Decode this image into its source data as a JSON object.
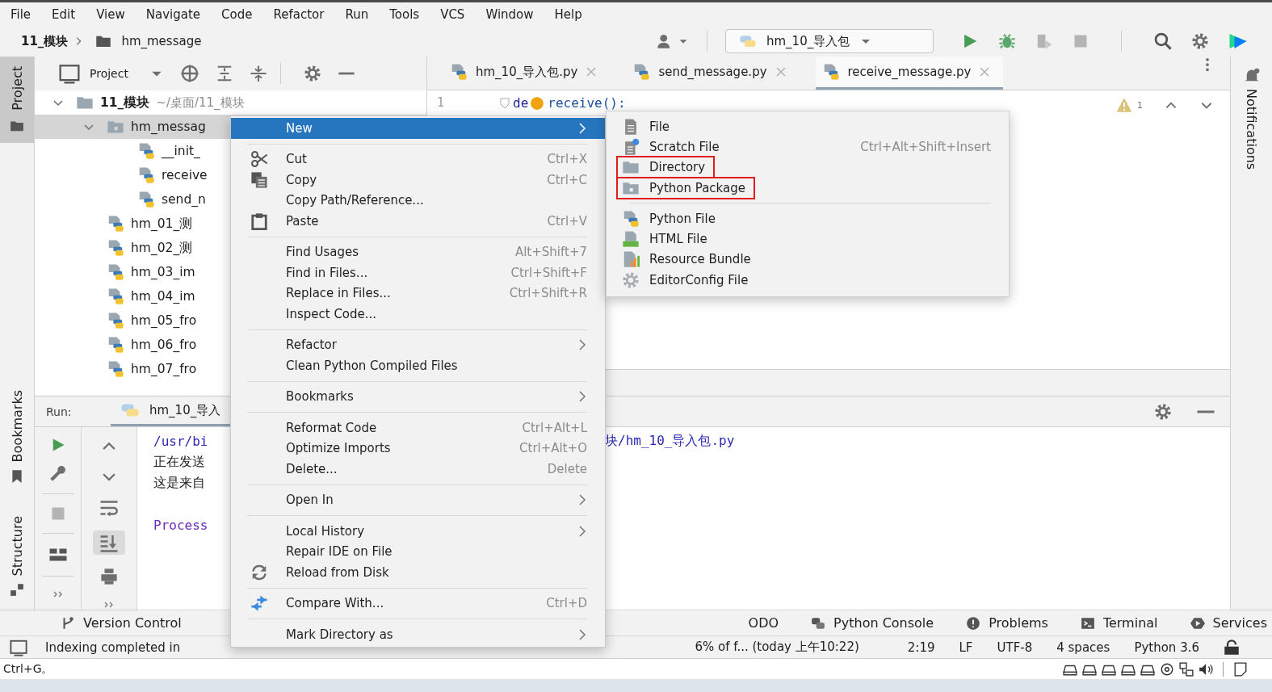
{
  "menu_bar": [
    "File",
    "Edit",
    "View",
    "Navigate",
    "Code",
    "Refactor",
    "Run",
    "Tools",
    "VCS",
    "Window",
    "Help"
  ],
  "breadcrumb": {
    "project": "11_模块",
    "folder": "hm_message"
  },
  "run_config": {
    "label": "hm_10_导入包"
  },
  "left_stripe": {
    "top": {
      "label": "Project",
      "selected": true
    },
    "bottom": [
      "Bookmarks",
      "Structure"
    ]
  },
  "right_stripe": {
    "label": "Notifications"
  },
  "project_panel": {
    "title": "Project",
    "tree": [
      {
        "label": "11_模块",
        "path": "~/桌面/11_模块",
        "kind": "folder",
        "expanded": true,
        "selected": false,
        "children": [
          {
            "label": "hm_messag",
            "kind": "package",
            "expanded": true,
            "selected": true,
            "children": [
              {
                "label": "__init_",
                "kind": "python",
                "selected": false
              },
              {
                "label": "receive",
                "kind": "python",
                "selected": false
              },
              {
                "label": "send_n",
                "kind": "python",
                "selected": false
              }
            ]
          },
          {
            "label": "hm_01_测",
            "kind": "python",
            "selected": false
          },
          {
            "label": "hm_02_测",
            "kind": "python",
            "selected": false
          },
          {
            "label": "hm_03_im",
            "kind": "python",
            "selected": false
          },
          {
            "label": "hm_04_im",
            "kind": "python",
            "selected": false
          },
          {
            "label": "hm_05_fro",
            "kind": "python",
            "selected": false
          },
          {
            "label": "hm_06_fro",
            "kind": "python",
            "selected": false
          },
          {
            "label": "hm_07_fro",
            "kind": "python",
            "selected": false
          }
        ]
      }
    ]
  },
  "editor": {
    "tabs": [
      {
        "label": "hm_10_导入包.py",
        "selected": false
      },
      {
        "label": "send_message.py",
        "selected": false
      },
      {
        "label": "receive_message.py",
        "selected": true
      }
    ],
    "line_number": "1",
    "code_keyword": "de",
    "code_rest": "receive():",
    "warning_count": "1"
  },
  "run_panel": {
    "label": "Run:",
    "tab": "hm_10_导入",
    "console": [
      {
        "kind": "command",
        "text": "/usr/bi",
        "tail": "块/hm_10_导入包.py"
      },
      {
        "kind": "output",
        "text": "正在发送"
      },
      {
        "kind": "output",
        "text": "这是来自"
      },
      {
        "kind": "exit",
        "text": "Process"
      }
    ]
  },
  "tool_window_bar": [
    {
      "kind": "vcs",
      "label": "Version Control"
    },
    {
      "kind": "todo",
      "label": "ODO"
    },
    {
      "kind": "console",
      "label": "Python Console"
    },
    {
      "kind": "problems",
      "label": "Problems"
    },
    {
      "kind": "terminal",
      "label": "Terminal"
    },
    {
      "kind": "services",
      "label": "Services"
    }
  ],
  "status_bar": {
    "message": "Indexing completed in",
    "vcs_info": "6% of f... (today 上午10:22)",
    "fields": [
      "2:19",
      "LF",
      "UTF-8",
      "4 spaces",
      "Python 3.6"
    ]
  },
  "os_bar": {
    "hint": "Ctrl+G。"
  },
  "context_menu": {
    "items": [
      {
        "kind": "plain",
        "label": "New",
        "submenu": true,
        "selected": true
      },
      {
        "kind": "separator"
      },
      {
        "kind": "cut",
        "label": "Cut",
        "shortcut": "Ctrl+X",
        "submenu": false,
        "selected": false
      },
      {
        "kind": "copy",
        "label": "Copy",
        "shortcut": "Ctrl+C",
        "submenu": false,
        "selected": false
      },
      {
        "kind": "plain",
        "label": "Copy Path/Reference...",
        "submenu": false,
        "selected": false
      },
      {
        "kind": "paste",
        "label": "Paste",
        "shortcut": "Ctrl+V",
        "submenu": false,
        "selected": false
      },
      {
        "kind": "separator"
      },
      {
        "kind": "plain",
        "label": "Find Usages",
        "shortcut": "Alt+Shift+7",
        "submenu": false,
        "selected": false
      },
      {
        "kind": "plain",
        "label": "Find in Files...",
        "shortcut": "Ctrl+Shift+F",
        "submenu": false,
        "selected": false
      },
      {
        "kind": "plain",
        "label": "Replace in Files...",
        "shortcut": "Ctrl+Shift+R",
        "submenu": false,
        "selected": false
      },
      {
        "kind": "plain",
        "label": "Inspect Code...",
        "submenu": false,
        "selected": false
      },
      {
        "kind": "separator"
      },
      {
        "kind": "plain",
        "label": "Refactor",
        "submenu": true,
        "selected": false
      },
      {
        "kind": "plain",
        "label": "Clean Python Compiled Files",
        "submenu": false,
        "selected": false
      },
      {
        "kind": "separator"
      },
      {
        "kind": "plain",
        "label": "Bookmarks",
        "submenu": true,
        "selected": false
      },
      {
        "kind": "separator"
      },
      {
        "kind": "plain",
        "label": "Reformat Code",
        "shortcut": "Ctrl+Alt+L",
        "submenu": false,
        "selected": false
      },
      {
        "kind": "plain",
        "label": "Optimize Imports",
        "shortcut": "Ctrl+Alt+O",
        "submenu": false,
        "selected": false
      },
      {
        "kind": "plain",
        "label": "Delete...",
        "shortcut": "Delete",
        "submenu": false,
        "selected": false
      },
      {
        "kind": "separator"
      },
      {
        "kind": "plain",
        "label": "Open In",
        "submenu": true,
        "selected": false
      },
      {
        "kind": "separator"
      },
      {
        "kind": "plain",
        "label": "Local History",
        "submenu": true,
        "selected": false
      },
      {
        "kind": "plain",
        "label": "Repair IDE on File",
        "submenu": false,
        "selected": false
      },
      {
        "kind": "reload",
        "label": "Reload from Disk",
        "submenu": false,
        "selected": false
      },
      {
        "kind": "separator"
      },
      {
        "kind": "compare",
        "label": "Compare With...",
        "shortcut": "Ctrl+D",
        "submenu": false,
        "selected": false
      },
      {
        "kind": "separator"
      },
      {
        "kind": "plain",
        "label": "Mark Directory as",
        "submenu": true,
        "selected": false
      }
    ]
  },
  "submenu": {
    "items": [
      {
        "kind": "file",
        "label": "File",
        "annotated": false
      },
      {
        "kind": "scratch",
        "label": "Scratch File",
        "shortcut": "Ctrl+Alt+Shift+Insert",
        "annotated": false
      },
      {
        "kind": "folder",
        "label": "Directory",
        "annotated": true
      },
      {
        "kind": "package",
        "label": "Python Package",
        "annotated": true
      },
      {
        "kind": "separator"
      },
      {
        "kind": "python",
        "label": "Python File",
        "annotated": false
      },
      {
        "kind": "html",
        "label": "HTML File",
        "annotated": false
      },
      {
        "kind": "bundle",
        "label": "Resource Bundle",
        "annotated": false
      },
      {
        "kind": "config",
        "label": "EditorConfig File",
        "annotated": false
      }
    ]
  }
}
